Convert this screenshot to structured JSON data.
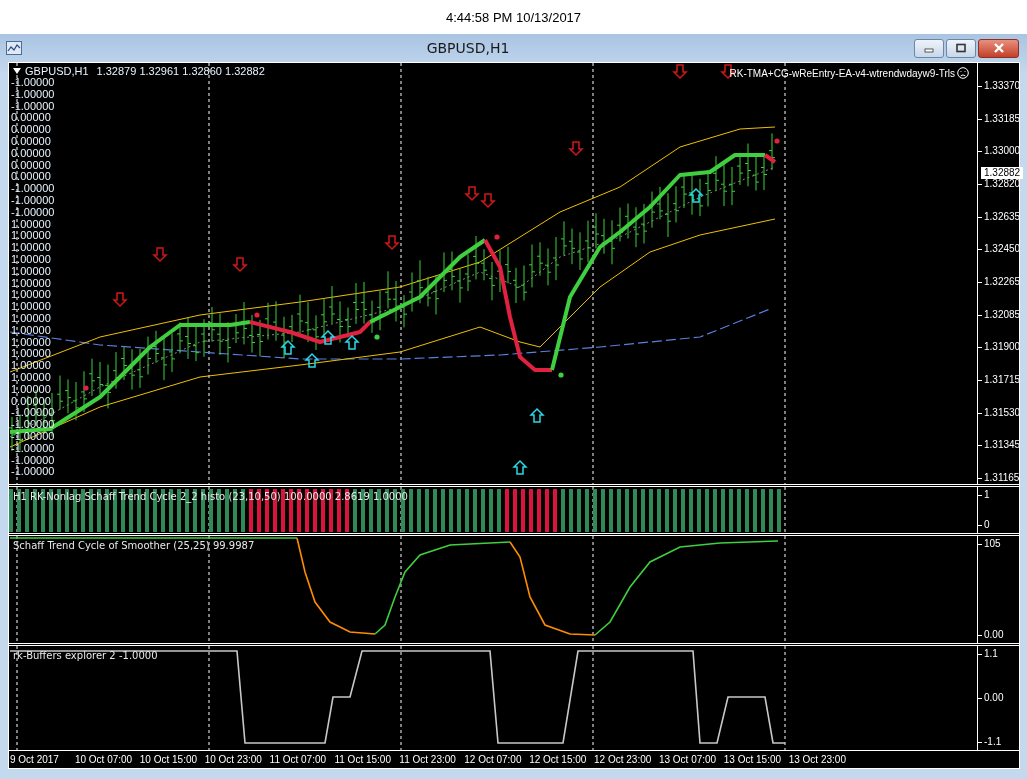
{
  "clock": "4:44:58 PM 10/13/2017",
  "window": {
    "title": "GBPUSD,H1",
    "buttons": [
      {
        "kind": "minimize"
      },
      {
        "kind": "maximize"
      },
      {
        "kind": "close"
      }
    ]
  },
  "main_pane": {
    "symbol": "GBPUSD,H1",
    "ohlc": "1.32879 1.32961 1.32860 1.32882",
    "expert": "RK-TMA+CG-wReEntry-EA-v4-wtrendwdayw9-Trls",
    "buffer_values": [
      "-1.00000",
      "-1.00000",
      "-1.00000",
      "0.00000",
      "0.00000",
      "0.00000",
      "0.00000",
      "0.00000",
      "0.00000",
      "-1.00000",
      "-1.00000",
      "-1.00000",
      "1.00000",
      "1.00000",
      "1.00000",
      "1.00000",
      "1.00000",
      "1.00000",
      "1.00000",
      "1.00000",
      "1.00000",
      "1.00000",
      "1.00000",
      "1.00000",
      "1.00000",
      "1.00000",
      "1.00000",
      "0.00000",
      "-1.00000",
      "-1.00000",
      "-1.00000",
      "-1.00000",
      "-1.00000",
      "-1.00000"
    ],
    "price_axis": [
      "1.33370",
      "1.33185",
      "1.33000",
      "1.32820",
      "1.32635",
      "1.32450",
      "1.32265",
      "1.32085",
      "1.31900",
      "1.31715",
      "1.31530",
      "1.31345",
      "1.31165"
    ],
    "current_price": "1.32882"
  },
  "histo_pane": {
    "label": "H1 RK-Nonlag Schaff Trend Cycle 2_2 histo  (23,10,50) 100.0000 2.8619 1.0000",
    "axis": [
      "1",
      "0"
    ]
  },
  "schaff_pane": {
    "label": "Schaff Trend Cycle of Smoother (25,25) 99.9987",
    "axis": [
      "105",
      "0.00"
    ]
  },
  "buffers_pane": {
    "label": "rk-Buffers explorer 2 -1.0000",
    "axis": [
      "1.1",
      "0.00",
      "-1.1"
    ]
  },
  "time_axis": [
    "9 Oct 2017",
    "10 Oct 07:00",
    "10 Oct 15:00",
    "10 Oct 23:00",
    "11 Oct 07:00",
    "11 Oct 15:00",
    "11 Oct 23:00",
    "12 Oct 07:00",
    "12 Oct 15:00",
    "12 Oct 23:00",
    "13 Oct 07:00",
    "13 Oct 15:00",
    "13 Oct 23:00"
  ]
}
